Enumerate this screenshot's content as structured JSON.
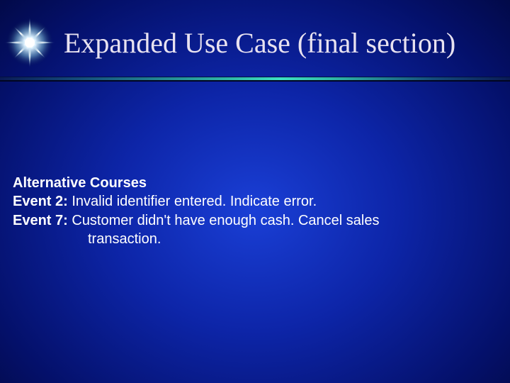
{
  "title": "Expanded Use Case (final section)",
  "section_heading": "Alternative Courses",
  "events": [
    {
      "label": "Event 2:",
      "text": "  Invalid identifier entered.  Indicate error."
    },
    {
      "label": "Event 7:",
      "text_a": "  Customer didn't have enough cash.  Cancel sales",
      "text_b": "transaction."
    }
  ]
}
